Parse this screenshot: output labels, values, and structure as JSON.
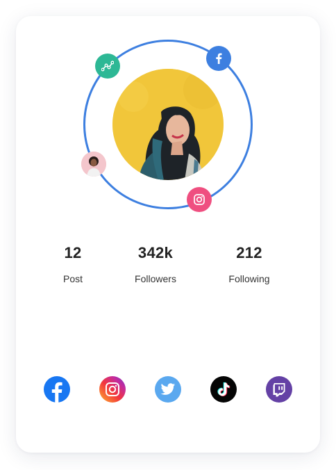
{
  "profile": {
    "photo_alt": "Profile photo",
    "orbit_icons": [
      "analytics-icon",
      "facebook-icon",
      "friend-avatar",
      "instagram-icon"
    ]
  },
  "stats": [
    {
      "value": "12",
      "label": "Post"
    },
    {
      "value": "342k",
      "label": "Followers"
    },
    {
      "value": "212",
      "label": "Following"
    }
  ],
  "social_links": [
    "facebook-icon",
    "instagram-icon",
    "twitter-icon",
    "tiktok-icon",
    "twitch-icon"
  ],
  "colors": {
    "orbit": "#3d7fe0",
    "analytics": "#2db895",
    "facebook": "#1877f2",
    "instagram_badge": "#ef4f80",
    "twitter": "#5aa8ef",
    "tiktok": "#050505",
    "twitch": "#6441a5",
    "photo_background": "#f1c63a"
  }
}
